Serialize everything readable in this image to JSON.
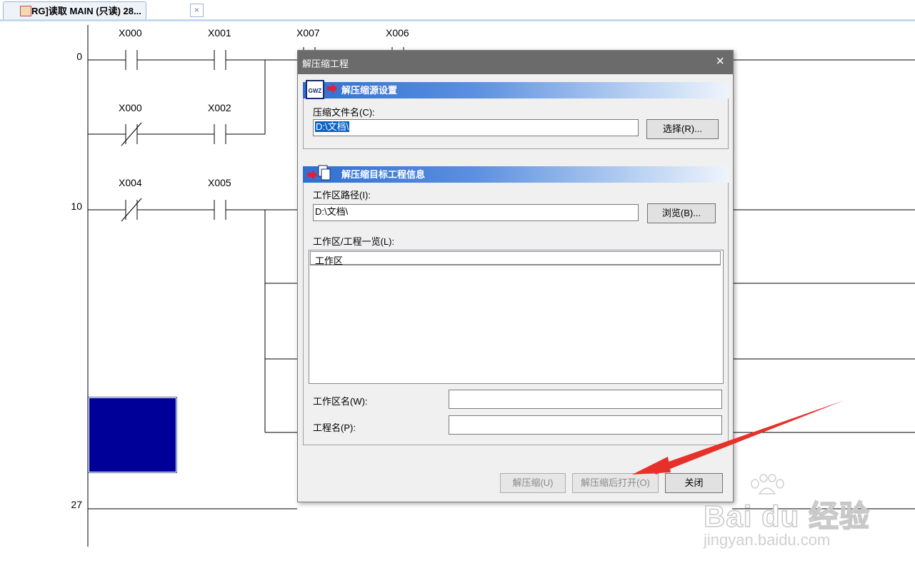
{
  "tab": {
    "title": "[PRG]读取 MAIN (只读) 28...",
    "close": "×"
  },
  "ladder": {
    "step_numbers": [
      "0",
      "10",
      "27"
    ],
    "rows": [
      [
        "X000",
        "X001",
        "X007",
        "X006"
      ],
      [
        "X000",
        "X002"
      ],
      [
        "X004",
        "X005"
      ]
    ]
  },
  "dialog": {
    "title": "解压缩工程",
    "close": "×",
    "source": {
      "header": "解压缩源设置",
      "icon_text": "GWZ",
      "file_label": "压缩文件名(C):",
      "file_value": "D:\\文档\\",
      "select_button": "选择(R)..."
    },
    "target": {
      "header": "解压缩目标工程信息",
      "path_label": "工作区路径(I):",
      "path_value": "D:\\文档\\",
      "browse_button": "浏览(B)...",
      "list_label": "工作区/工程一览(L):",
      "list_column": "工作区",
      "workspace_label": "工作区名(W):",
      "workspace_value": "",
      "project_label": "工程名(P):",
      "project_value": ""
    },
    "buttons": {
      "extract": "解压缩(U)",
      "extract_open": "解压缩后打开(O)",
      "close": "关闭"
    }
  },
  "watermark": {
    "main": "Bai du 经验",
    "sub": "jingyan.baidu.com"
  },
  "colors": {
    "header_blue": "#2f6fd0",
    "titlebar": "#6b6b6b",
    "annotation_arrow": "#e8302a",
    "block": "#000099"
  }
}
